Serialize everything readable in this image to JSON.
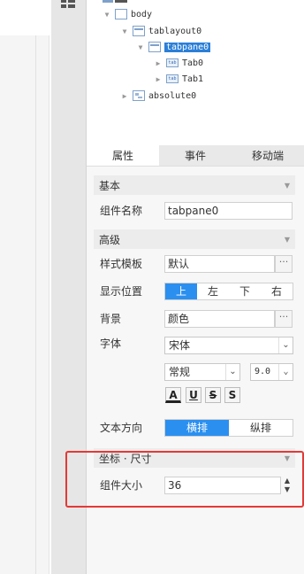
{
  "tree": {
    "root_label": "body",
    "nodes": [
      {
        "label": "tablayout0",
        "icon": "frame-icon"
      },
      {
        "label": "tabpane0",
        "icon": "frame-icon",
        "selected": true
      },
      {
        "label": "Tab0",
        "icon": "tab-icon",
        "badge": "tab"
      },
      {
        "label": "Tab1",
        "icon": "tab-icon",
        "badge": "tab"
      },
      {
        "label": "absolute0",
        "icon": "absolute-icon"
      }
    ]
  },
  "tabs": [
    "属性",
    "事件",
    "移动端"
  ],
  "sections": {
    "basic": "基本",
    "advanced": "高级",
    "coord": "坐标 · 尺寸"
  },
  "fields": {
    "component_name_label": "组件名称",
    "component_name_value": "tabpane0",
    "style_template_label": "样式模板",
    "style_template_value": "默认",
    "display_position_label": "显示位置",
    "positions": [
      "上",
      "左",
      "下",
      "右"
    ],
    "background_label": "背景",
    "background_value": "颜色",
    "font_label": "字体",
    "font_family": "宋体",
    "font_style": "常规",
    "font_size": "9.0",
    "font_buttons": [
      "A",
      "U",
      "S",
      "S"
    ],
    "text_direction_label": "文本方向",
    "directions": [
      "横排",
      "纵排"
    ],
    "component_size_label": "组件大小",
    "component_size_value": "36"
  },
  "dots_label": "···",
  "colors": {
    "accent": "#2b8ff0",
    "highlight_box": "#e53935"
  }
}
